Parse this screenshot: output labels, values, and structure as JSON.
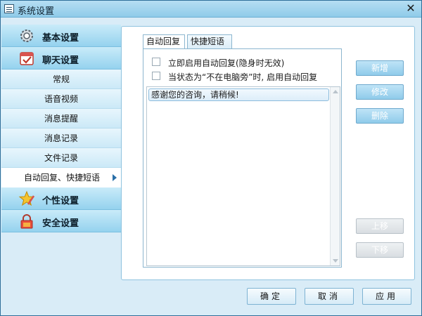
{
  "window": {
    "title": "系统设置",
    "close_glyph": "✕"
  },
  "sidebar": {
    "categories": [
      {
        "label": "基本设置",
        "icon": "gear-icon"
      },
      {
        "label": "聊天设置",
        "icon": "calendar-check-icon"
      },
      {
        "label": "个性设置",
        "icon": "star-brush-icon"
      },
      {
        "label": "安全设置",
        "icon": "lock-icon"
      }
    ],
    "chat_items": [
      {
        "label": "常规"
      },
      {
        "label": "语音视频"
      },
      {
        "label": "消息提醒"
      },
      {
        "label": "消息记录"
      },
      {
        "label": "文件记录"
      },
      {
        "label": "自动回复、快捷短语",
        "active": true
      }
    ]
  },
  "tabs": [
    {
      "label": "自动回复",
      "selected": true
    },
    {
      "label": "快捷短语",
      "selected": false
    }
  ],
  "options": {
    "enable_now": {
      "label": "立即启用自动回复(隐身时无效)",
      "checked": false
    },
    "enable_away": {
      "label": "当状态为“不在电脑旁”时, 启用自动回复",
      "checked": false
    }
  },
  "reply_list": {
    "items": [
      "感谢您的咨询，请稍候!"
    ]
  },
  "side_buttons": {
    "add": "新增",
    "edit": "修改",
    "delete": "删除",
    "move_up": "上移",
    "move_down": "下移"
  },
  "footer": {
    "ok": "确定",
    "cancel": "取消",
    "apply": "应用"
  },
  "colors": {
    "accent": "#8fcbea",
    "sidebar_cat": "#95d2ee",
    "border": "#2f6f9a"
  }
}
